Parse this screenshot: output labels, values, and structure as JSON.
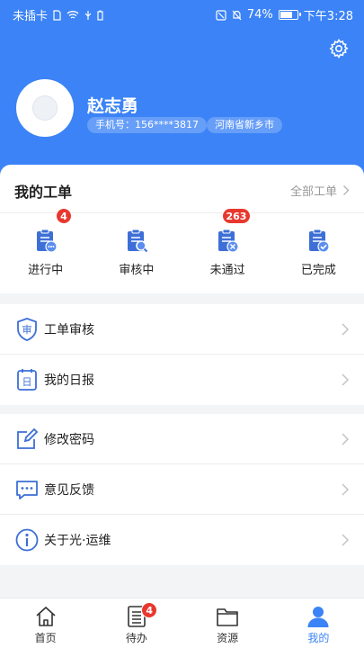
{
  "status_bar": {
    "carrier": "未插卡",
    "battery_percent": "74%",
    "battery_level": 0.74,
    "time": "下午3:28"
  },
  "profile": {
    "name": "赵志勇",
    "phone_chip": "手机号：156****3817",
    "region_chip": "河南省新乡市"
  },
  "orders": {
    "title": "我的工单",
    "all_label": "全部工单",
    "items": [
      {
        "label": "进行中",
        "badge": "4",
        "icon": "clipboard-progress-icon"
      },
      {
        "label": "审核中",
        "badge": "",
        "icon": "clipboard-search-icon"
      },
      {
        "label": "未通过",
        "badge": "263",
        "icon": "clipboard-rejected-icon"
      },
      {
        "label": "已完成",
        "badge": "",
        "icon": "clipboard-check-icon"
      }
    ]
  },
  "menu_group_1": [
    {
      "label": "工单审核",
      "icon": "audit-shield-icon"
    },
    {
      "label": "我的日报",
      "icon": "daily-report-icon"
    }
  ],
  "menu_group_2": [
    {
      "label": "修改密码",
      "icon": "edit-icon"
    },
    {
      "label": "意见反馈",
      "icon": "feedback-icon"
    },
    {
      "label": "关于光·运维",
      "icon": "info-icon"
    }
  ],
  "tabbar": {
    "items": [
      {
        "label": "首页",
        "icon": "home-icon",
        "active": false,
        "badge": ""
      },
      {
        "label": "待办",
        "icon": "todo-list-icon",
        "active": false,
        "badge": "4"
      },
      {
        "label": "资源",
        "icon": "folder-icon",
        "active": false,
        "badge": ""
      },
      {
        "label": "我的",
        "icon": "user-icon",
        "active": true,
        "badge": ""
      }
    ]
  },
  "colors": {
    "primary": "#3b83f6",
    "badge": "#e8382e",
    "icon_blue": "#3d6fd6"
  }
}
